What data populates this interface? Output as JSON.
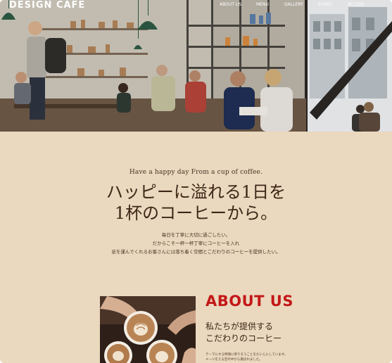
{
  "header": {
    "logo": "DESIGN CAFE",
    "nav": [
      "ABOUT US",
      "MENU",
      "GALLERY",
      "EVENT",
      "ACCESS"
    ]
  },
  "hero": {
    "image": "cafe-interior-photo"
  },
  "intro": {
    "tagline": "Have a happy day From a cup of coffee.",
    "headline_line1": "ハッピーに溢れる1日を",
    "headline_line2": "1杯のコーヒーから。",
    "desc_line1": "毎日を丁寧に大切に過ごしたい。",
    "desc_line2": "だからこそ一杯一杯丁寧にコーヒーを入れ",
    "desc_line3": "足を運んでくれるお客さんには落ち着く空間とこだわりのコーヒーを提供したい。"
  },
  "about": {
    "title": "ABOUT US",
    "subtitle_line1": "私たちが提供する",
    "subtitle_line2": "こだわりのコーヒー",
    "text_line1": "テーマにする時間に寄りそうことをだいじにしています。",
    "text_line2": "メージをえる空の中から選ばれました。",
    "image": "latte-art-photo"
  },
  "colors": {
    "background": "#ead8bf",
    "accent": "#c41818",
    "text": "#3d2616"
  }
}
